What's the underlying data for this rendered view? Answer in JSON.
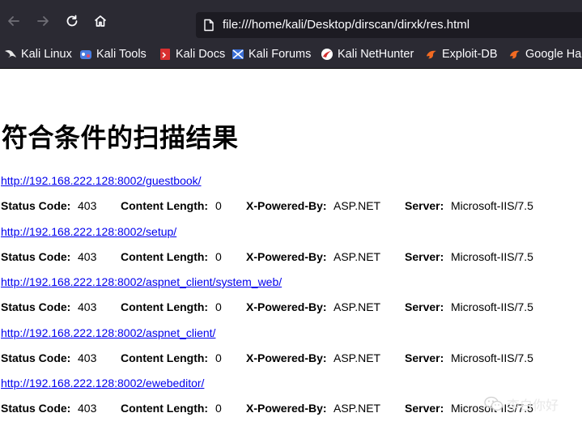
{
  "browser": {
    "url": "file:///home/kali/Desktop/dirscan/dirxk/res.html",
    "bookmarks": [
      {
        "label": "Kali Linux",
        "icon": "kali-dragon-icon"
      },
      {
        "label": "Kali Tools",
        "icon": "kali-tools-icon"
      },
      {
        "label": "Kali Docs",
        "icon": "kali-docs-icon"
      },
      {
        "label": "Kali Forums",
        "icon": "kali-forums-icon"
      },
      {
        "label": "Kali NetHunter",
        "icon": "nethunter-icon"
      },
      {
        "label": "Exploit-DB",
        "icon": "exploit-db-icon"
      },
      {
        "label": "Google Hac",
        "icon": "google-hacking-icon"
      }
    ]
  },
  "page": {
    "title": "符合条件的扫描结果",
    "labels": {
      "status_code": "Status Code:",
      "content_length": "Content Length:",
      "x_powered_by": "X-Powered-By:",
      "server": "Server:"
    },
    "results": [
      {
        "url": "http://192.168.222.128:8002/guestbook/",
        "status": "403",
        "length": "0",
        "powered": "ASP.NET",
        "server": "Microsoft-IIS/7.5"
      },
      {
        "url": "http://192.168.222.128:8002/setup/",
        "status": "403",
        "length": "0",
        "powered": "ASP.NET",
        "server": "Microsoft-IIS/7.5"
      },
      {
        "url": "http://192.168.222.128:8002/aspnet_client/system_web/",
        "status": "403",
        "length": "0",
        "powered": "ASP.NET",
        "server": "Microsoft-IIS/7.5"
      },
      {
        "url": "http://192.168.222.128:8002/aspnet_client/",
        "status": "403",
        "length": "0",
        "powered": "ASP.NET",
        "server": "Microsoft-IIS/7.5"
      },
      {
        "url": "http://192.168.222.128:8002/ewebeditor/",
        "status": "403",
        "length": "0",
        "powered": "ASP.NET",
        "server": "Microsoft-IIS/7.5"
      }
    ]
  },
  "watermark": {
    "text": "李白你好",
    "icon": "wechat-icon"
  }
}
